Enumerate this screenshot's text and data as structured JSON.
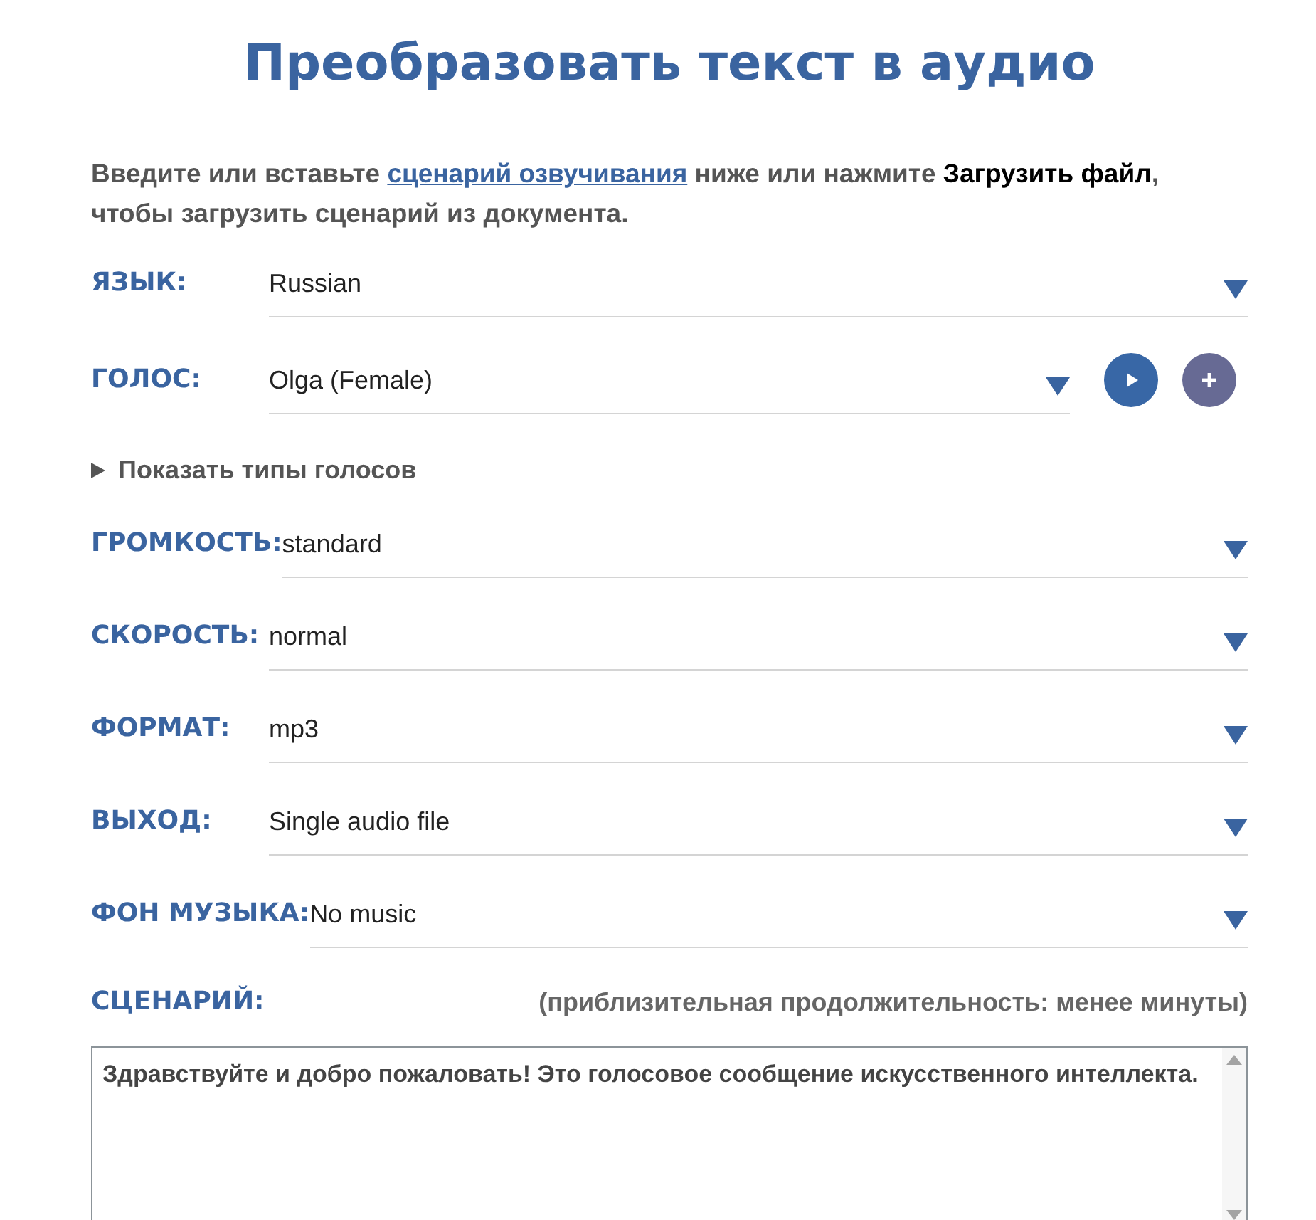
{
  "title": "Преобразовать текст в аудио",
  "intro": {
    "before": "Введите или вставьте",
    "link": "сценарий озвучивания",
    "after": "ниже или нажмите **Загрузить файл**, чтобы загрузить сценарий из документа."
  },
  "fields": [
    {
      "kind": "select",
      "label": "ЯЗЫК:",
      "value": "Russian"
    },
    {
      "kind": "voice",
      "label": "ГОЛОС:",
      "value": "Olga (Female)"
    },
    {
      "kind": "toggle",
      "label": "Показать типы голосов",
      "expanded": false
    },
    {
      "kind": "select",
      "label": "ГРОМКОСТЬ:",
      "value": "standard"
    },
    {
      "kind": "select",
      "label": "СКОРОСТЬ:",
      "value": "normal"
    },
    {
      "kind": "select",
      "label": "ФОРМАТ:",
      "value": "mp3"
    },
    {
      "kind": "select",
      "label": "ВЫХОД:",
      "value": "Single audio file"
    },
    {
      "kind": "select",
      "label": "ФОН МУЗЫКА:",
      "value": "No music"
    }
  ],
  "script": {
    "label": "СЦЕНАРИЙ:",
    "duration": "(приблизительная продолжительность: менее минуты)",
    "value": "Здравствуйте и добро пожаловать! Это голосовое сообщение искусственного интеллекта."
  }
}
